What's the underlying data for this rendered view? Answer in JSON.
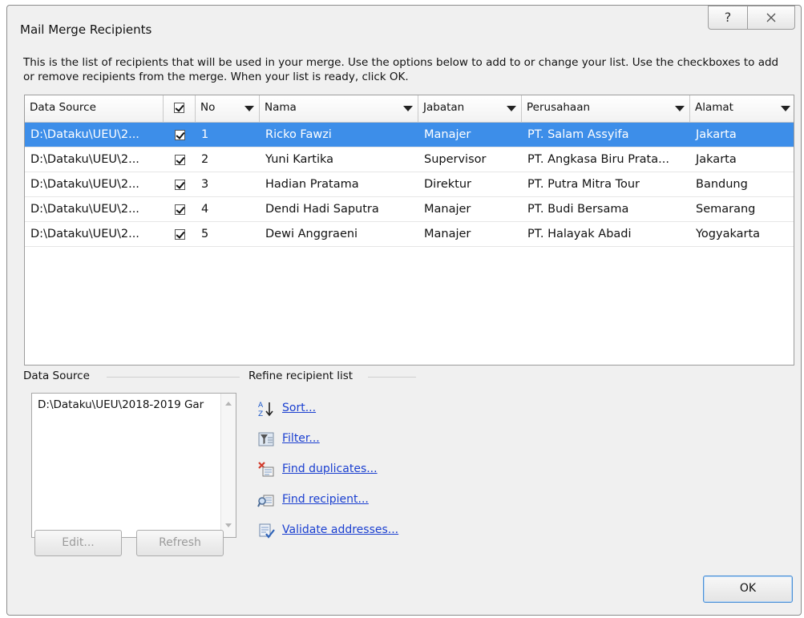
{
  "window": {
    "title": "Mail Merge Recipients",
    "help_glyph": "?"
  },
  "instructions": "This is the list of recipients that will be used in your merge.  Use the options below to add to or change your list.  Use the checkboxes to add or remove recipients from the merge.  When your list is ready, click OK.",
  "table": {
    "columns": {
      "source": "Data Source",
      "no": "No",
      "nama": "Nama",
      "jabatan": "Jabatan",
      "perusahaan": "Perusahaan",
      "alamat": "Alamat"
    },
    "rows": [
      {
        "source": "D:\\Dataku\\UEU\\2...",
        "checked": true,
        "no": "1",
        "nama": "Ricko Fawzi",
        "jabatan": "Manajer",
        "perusahaan": "PT. Salam Assyifa",
        "alamat": "Jakarta",
        "selected": true
      },
      {
        "source": "D:\\Dataku\\UEU\\2...",
        "checked": true,
        "no": "2",
        "nama": "Yuni Kartika",
        "jabatan": "Supervisor",
        "perusahaan": "PT. Angkasa Biru Prata...",
        "alamat": "Jakarta",
        "selected": false
      },
      {
        "source": "D:\\Dataku\\UEU\\2...",
        "checked": true,
        "no": "3",
        "nama": "Hadian Pratama",
        "jabatan": "Direktur",
        "perusahaan": "PT. Putra Mitra Tour",
        "alamat": "Bandung",
        "selected": false
      },
      {
        "source": "D:\\Dataku\\UEU\\2...",
        "checked": true,
        "no": "4",
        "nama": "Dendi Hadi Saputra",
        "jabatan": "Manajer",
        "perusahaan": "PT. Budi Bersama",
        "alamat": "Semarang",
        "selected": false
      },
      {
        "source": "D:\\Dataku\\UEU\\2...",
        "checked": true,
        "no": "5",
        "nama": "Dewi Anggraeni",
        "jabatan": "Manajer",
        "perusahaan": "PT. Halayak Abadi",
        "alamat": "Yogyakarta",
        "selected": false
      }
    ],
    "selected_row_color": "#3d8ee9"
  },
  "data_source": {
    "label": "Data Source",
    "item": "D:\\Dataku\\UEU\\2018-2019 Gar",
    "edit_label": "Edit...",
    "refresh_label": "Refresh"
  },
  "refine": {
    "label": "Refine recipient list",
    "items": [
      {
        "label": "Sort...",
        "icon": "sort-az-icon"
      },
      {
        "label": "Filter...",
        "icon": "filter-icon"
      },
      {
        "label": "Find duplicates...",
        "icon": "find-duplicates-icon"
      },
      {
        "label": "Find recipient...",
        "icon": "find-recipient-icon"
      },
      {
        "label": "Validate addresses...",
        "icon": "validate-addresses-icon"
      }
    ]
  },
  "ok_label": "OK"
}
